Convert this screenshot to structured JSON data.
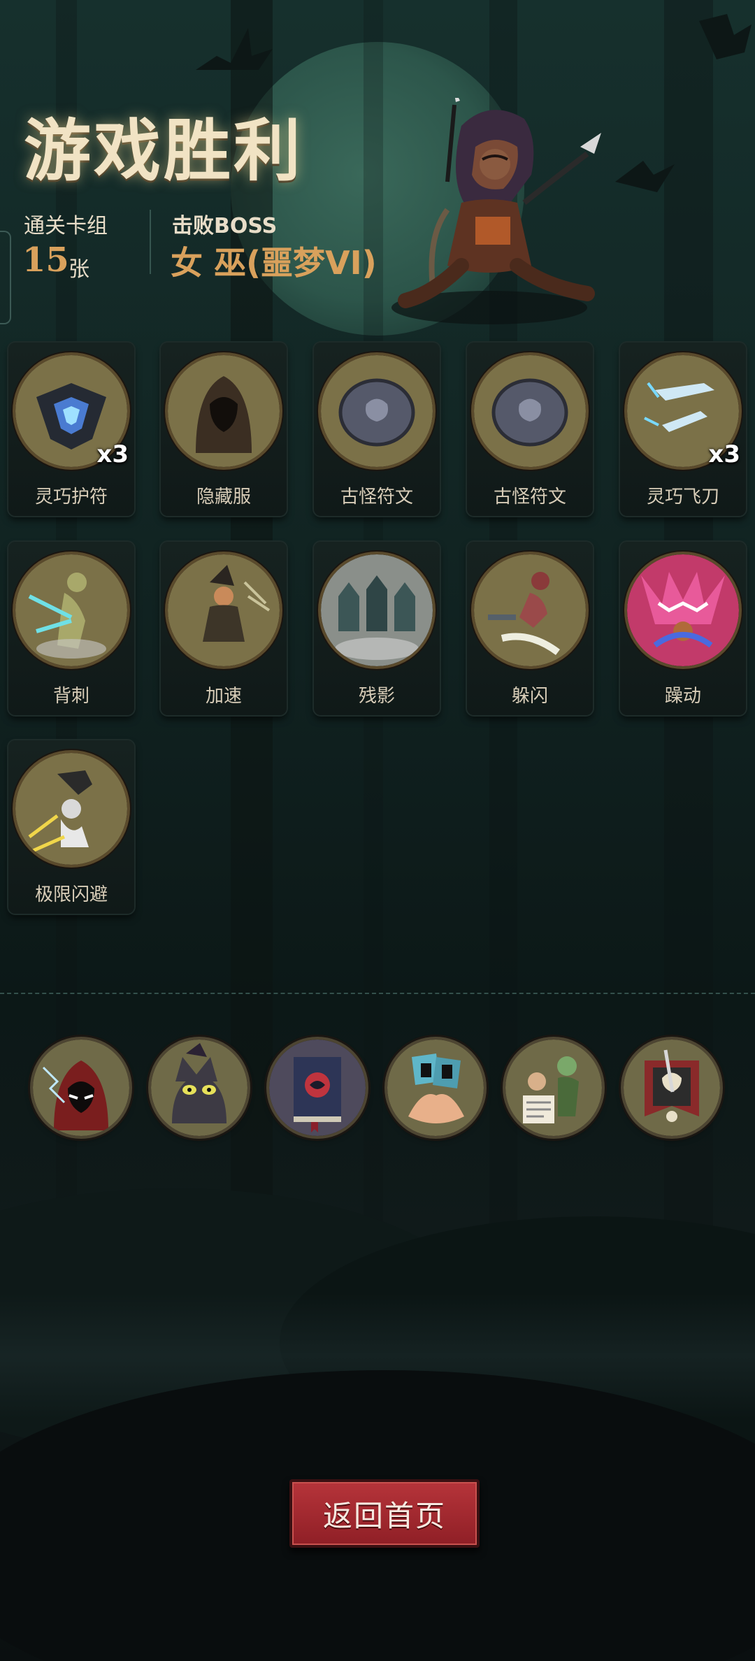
{
  "result": {
    "title": "游戏胜利"
  },
  "stats": {
    "deck_label": "通关卡组",
    "deck_value": "15",
    "deck_unit": "张",
    "boss_label": "击败BOSS",
    "boss_name": "女 巫(噩梦VI)"
  },
  "cards": [
    {
      "name": "灵巧护符",
      "count": "x3",
      "icon": "charm-icon"
    },
    {
      "name": "隐藏服",
      "count": "",
      "icon": "hood-cloak-icon"
    },
    {
      "name": "古怪符文",
      "count": "",
      "icon": "rune-stone-icon"
    },
    {
      "name": "古怪符文",
      "count": "",
      "icon": "rune-stone-icon"
    },
    {
      "name": "灵巧飞刀",
      "count": "x3",
      "icon": "flying-knife-icon"
    },
    {
      "name": "背刺",
      "count": "",
      "icon": "backstab-icon"
    },
    {
      "name": "加速",
      "count": "",
      "icon": "haste-witch-icon"
    },
    {
      "name": "残影",
      "count": "",
      "icon": "afterimage-icon"
    },
    {
      "name": "躲闪",
      "count": "",
      "icon": "dodge-icon"
    },
    {
      "name": "躁动",
      "count": "",
      "icon": "frenzy-icon"
    },
    {
      "name": "极限闪避",
      "count": "",
      "icon": "extreme-dodge-icon"
    }
  ],
  "relics": [
    {
      "icon": "hooded-mage-icon"
    },
    {
      "icon": "black-cat-icon"
    },
    {
      "icon": "spell-book-icon"
    },
    {
      "icon": "card-hand-icon"
    },
    {
      "icon": "zombie-scholar-icon"
    },
    {
      "icon": "skull-banner-icon"
    }
  ],
  "actions": {
    "home_label": "返回首页"
  },
  "colors": {
    "accent_gold": "#d9a15c",
    "button_red": "#a62b31",
    "background": "#132826"
  }
}
